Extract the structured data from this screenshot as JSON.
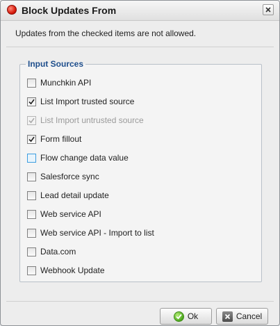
{
  "dialog": {
    "title": "Block Updates From",
    "intro": "Updates from the checked items are not allowed."
  },
  "input_sources": {
    "legend": "Input Sources",
    "items": [
      {
        "label": "Munchkin API",
        "checked": false,
        "disabled": false
      },
      {
        "label": "List Import trusted source",
        "checked": true,
        "disabled": false
      },
      {
        "label": "List Import untrusted source",
        "checked": true,
        "disabled": true
      },
      {
        "label": "Form fillout",
        "checked": true,
        "disabled": false
      },
      {
        "label": "Flow change data value",
        "checked": false,
        "disabled": false,
        "focused": true
      },
      {
        "label": "Salesforce sync",
        "checked": false,
        "disabled": false
      },
      {
        "label": "Lead detail update",
        "checked": false,
        "disabled": false
      },
      {
        "label": "Web service API",
        "checked": false,
        "disabled": false
      },
      {
        "label": "Web service API - Import to list",
        "checked": false,
        "disabled": false
      },
      {
        "label": "Data.com",
        "checked": false,
        "disabled": false
      },
      {
        "label": "Webhook Update",
        "checked": false,
        "disabled": false
      }
    ]
  },
  "buttons": {
    "ok_label": "Ok",
    "cancel_label": "Cancel"
  },
  "colors": {
    "legend": "#1e4e8c",
    "title_icon": "#d81e0f",
    "ok_icon": "#4aa61c"
  }
}
